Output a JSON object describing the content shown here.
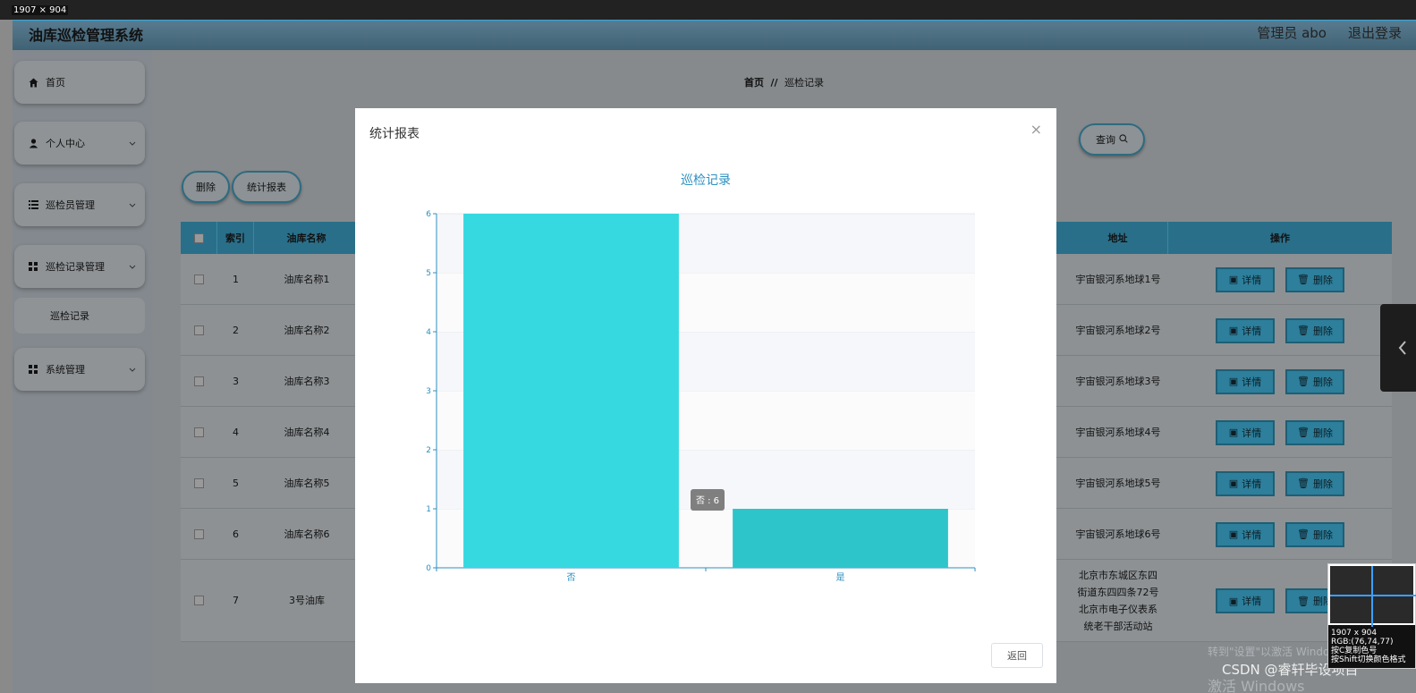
{
  "overlay": {
    "dimension_label": "1907 × 904"
  },
  "header": {
    "title": "油库巡检管理系统",
    "user": "管理员 abo",
    "logout": "退出登录"
  },
  "sidebar": {
    "items": [
      {
        "label": "首页",
        "icon": "home-icon"
      },
      {
        "label": "个人中心",
        "icon": "user-icon"
      },
      {
        "label": "巡检员管理",
        "icon": "list-icon"
      },
      {
        "label": "巡检记录管理",
        "icon": "grid-icon"
      },
      {
        "label": "巡检记录",
        "icon": ""
      },
      {
        "label": "系统管理",
        "icon": "grid-icon"
      }
    ]
  },
  "breadcrumb": {
    "home": "首页",
    "separator": "//",
    "current": "巡检记录"
  },
  "toolbar": {
    "delete_label": "删除",
    "report_label": "统计报表",
    "query_label": "查询"
  },
  "table": {
    "columns": [
      "索引",
      "油库名称",
      "地址",
      "操作"
    ],
    "rows": [
      {
        "index": "1",
        "name": "油库名称1",
        "address": "宇宙银河系地球1号"
      },
      {
        "index": "2",
        "name": "油库名称2",
        "address": "宇宙银河系地球2号"
      },
      {
        "index": "3",
        "name": "油库名称3",
        "address": "宇宙银河系地球3号"
      },
      {
        "index": "4",
        "name": "油库名称4",
        "address": "宇宙银河系地球4号"
      },
      {
        "index": "5",
        "name": "油库名称5",
        "address": "宇宙银河系地球5号"
      },
      {
        "index": "6",
        "name": "油库名称6",
        "address": "宇宙银河系地球6号"
      },
      {
        "index": "7",
        "name": "3号油库",
        "address": "北京市东城区东四街道东四四条72号北京市电子仪表系统老干部活动站"
      }
    ],
    "detail_label": "详情",
    "delete_label": "删除"
  },
  "modal": {
    "title": "统计报表",
    "close": "×",
    "back_label": "返回"
  },
  "chart_data": {
    "type": "bar",
    "title": "巡检记录",
    "categories": [
      "否",
      "是"
    ],
    "values": [
      6,
      1
    ],
    "ylim": [
      0,
      6
    ],
    "yticks": [
      "0",
      "1",
      "2",
      "3",
      "4",
      "5",
      "6"
    ],
    "colors": [
      "#35d9df",
      "#2ec5ca"
    ],
    "tooltip": "否 : 6",
    "grid": true
  },
  "watermark": {
    "line1": "激活 Windows",
    "line2": "转到\"设置\"以激活 Windows。"
  },
  "credit": "CSDN @睿轩毕设项目",
  "zoom": {
    "size": "1907 x 904",
    "rgb": "RGB:(76,74,77)",
    "hint1": "按C复制色号",
    "hint2": "按Shift切换颜色格式"
  }
}
